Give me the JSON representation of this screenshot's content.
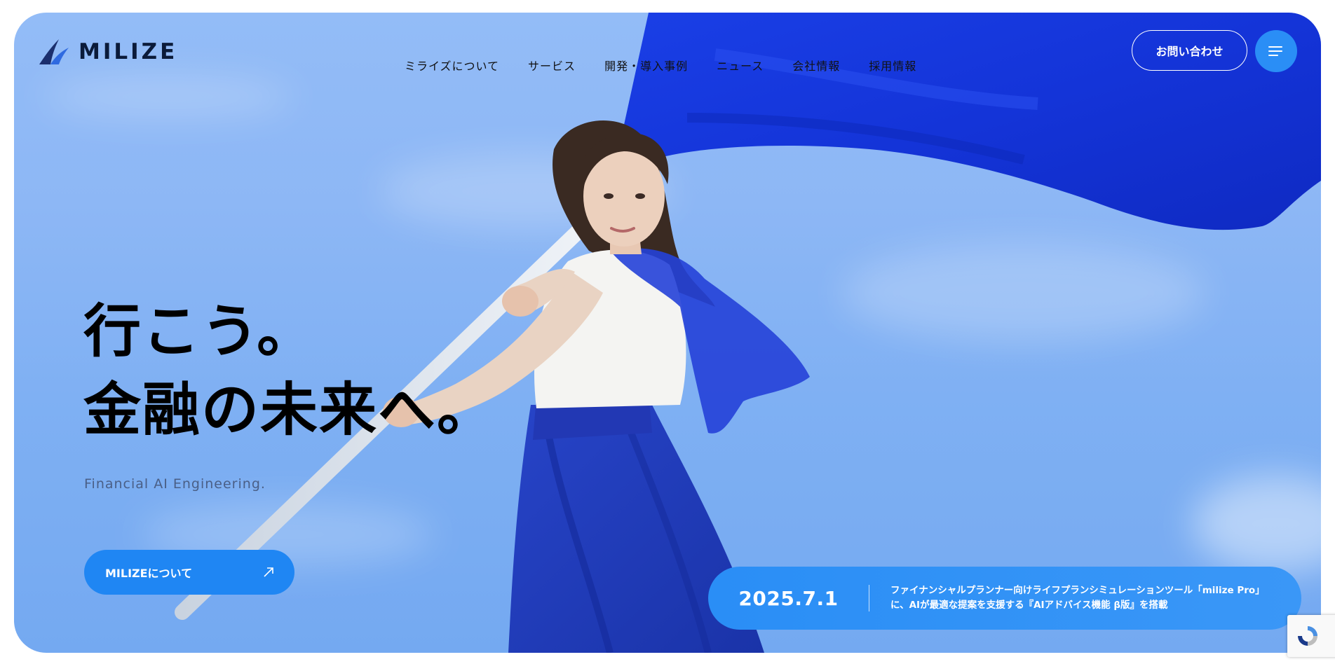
{
  "brand": {
    "name": "MILIZE",
    "logo_icon": "milize-logo-mark",
    "color": "#0b1b3a"
  },
  "nav": {
    "items": [
      {
        "label": "ミライズについて"
      },
      {
        "label": "サービス"
      },
      {
        "label": "開発・導入事例"
      },
      {
        "label": "ニュース"
      },
      {
        "label": "会社情報"
      },
      {
        "label": "採用情報"
      }
    ]
  },
  "header": {
    "contact_label": "お問い合わせ",
    "menu_icon": "hamburger-menu-icon"
  },
  "hero": {
    "headline_line1": "行こう。",
    "headline_line2": "金融の未来へ。",
    "tagline": "Financial AI Engineering.",
    "about_button_label": "MILIZEについて",
    "about_button_icon": "arrow-up-right-icon"
  },
  "news": {
    "date": "2025.7.1",
    "line1": "ファイナンシャルプランナー向けライフプランシミュレーションツール「milize Pro」",
    "line2": "に、AIが最適な提案を支援する『AIアドバイス機能 β版』を搭載"
  },
  "colors": {
    "accent_blue": "#1f86f3",
    "sky": "#8db7f5",
    "flag_blue": "#1438e0"
  },
  "widgets": {
    "recaptcha_icon": "recaptcha-icon"
  }
}
